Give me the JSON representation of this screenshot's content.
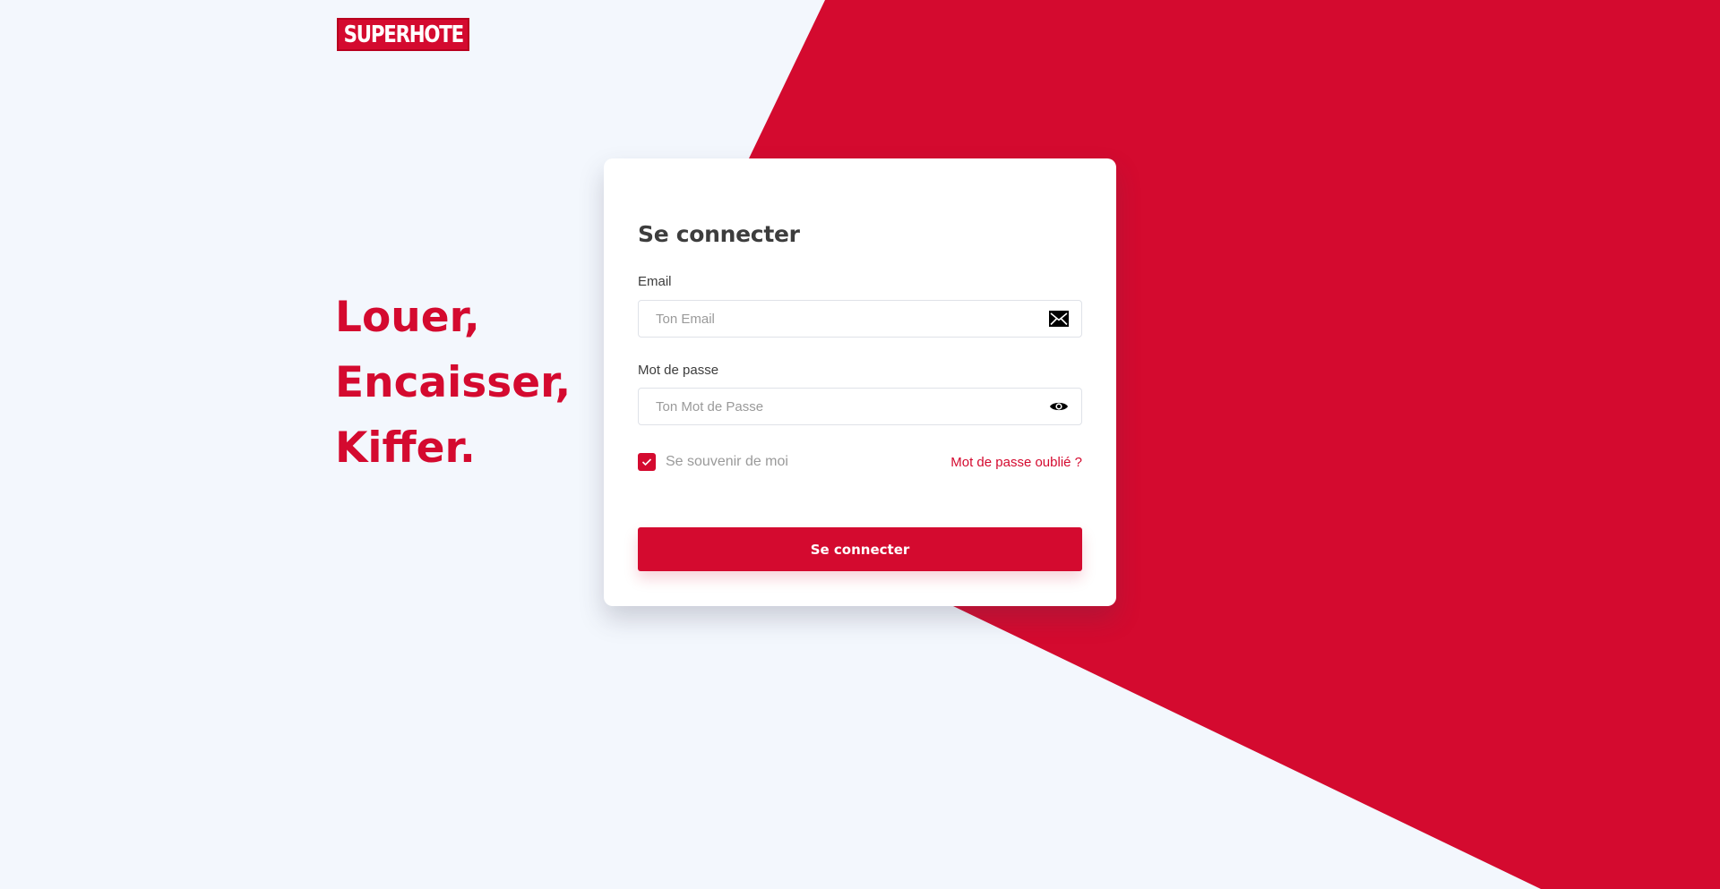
{
  "brand": {
    "logo_text": "SUPERHOTE",
    "accent_color": "#d40a2f",
    "background_color": "#f3f7fd"
  },
  "tagline": {
    "lines": [
      "Louer,",
      "Encaisser,",
      "Kiffer."
    ]
  },
  "login_form": {
    "title": "Se connecter",
    "email": {
      "label": "Email",
      "placeholder": "Ton Email",
      "icon": "envelope-icon"
    },
    "password": {
      "label": "Mot de passe",
      "placeholder": "Ton Mot de Passe",
      "icon": "eye-icon"
    },
    "remember_me": {
      "label": "Se souvenir de moi",
      "checked": true
    },
    "forgot_password_label": "Mot de passe oublié ?",
    "submit_label": "Se connecter"
  }
}
